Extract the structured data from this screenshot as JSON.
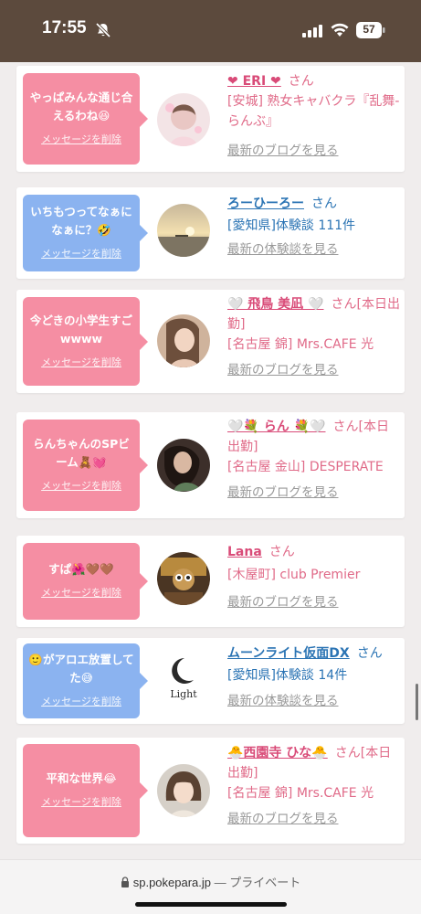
{
  "status_bar": {
    "time": "17:55",
    "battery": "57",
    "icons": [
      "mute-icon",
      "signal-icon",
      "wifi-icon",
      "battery-icon"
    ]
  },
  "colors": {
    "header": "#5c4a3d",
    "bubble_pink": "#f58ea3",
    "bubble_blue": "#8bb3f0",
    "name_pink": "#d94b78",
    "name_blue": "#2b74b4"
  },
  "messages": [
    {
      "bubble_text": "やっぱみんな通じ合えるわね😆",
      "delete_label": "メッセージを削除",
      "bubble_color": "pink",
      "avatar": "avatar-photo-1",
      "name": "❤ ERI ❤",
      "san": "さん",
      "shop": "[安城] 熟女キャバクラ『乱舞-らんぶ』",
      "link": "最新のブログを見る"
    },
    {
      "bubble_text": "いちもつってなぁになぁに？🤣",
      "delete_label": "メッセージを削除",
      "bubble_color": "blue",
      "avatar": "avatar-sunset",
      "name": "ろーひーろー",
      "san": "さん",
      "shop": "[愛知県]体験談 111件",
      "link": "最新の体験談を見る"
    },
    {
      "bubble_text": "今どきの小学生すごwwww",
      "delete_label": "メッセージを削除",
      "bubble_color": "pink",
      "avatar": "avatar-photo-3",
      "name": "🤍 飛鳥 美凪 🤍",
      "san": "さん[本日出勤]",
      "shop": "[名古屋 錦] Mrs.CAFE 光",
      "link": "最新のブログを見る"
    },
    {
      "bubble_text": "らんちゃんのSPビーム🧸💓",
      "delete_label": "メッセージを削除",
      "bubble_color": "pink",
      "avatar": "avatar-photo-4",
      "name": "🤍💐 らん 💐🤍",
      "san": "さん[本日出勤]",
      "shop": "[名古屋 金山] DESPERATE",
      "link": "最新のブログを見る"
    },
    {
      "bubble_text": "すぱ🌺🤎🤎",
      "delete_label": "メッセージを削除",
      "bubble_color": "pink",
      "avatar": "avatar-photo-5",
      "name": "Lana",
      "san": "さん",
      "shop": "[木屋町] club Premier",
      "link": "最新のブログを見る"
    },
    {
      "bubble_text": "🙂がアロエ放置してた😅",
      "delete_label": "メッセージを削除",
      "bubble_color": "blue",
      "avatar": "avatar-light-logo",
      "name": "ムーンライト仮面DX",
      "san": "さん",
      "shop": "[愛知県]体験談 14件",
      "link": "最新の体験談を見る",
      "logo_text": "Light"
    },
    {
      "bubble_text": "平和な世界😂",
      "delete_label": "メッセージを削除",
      "bubble_color": "pink",
      "avatar": "avatar-photo-7",
      "name": "🐣西園寺 ひな🐣",
      "san": "さん[本日出勤]",
      "shop": "[名古屋 錦] Mrs.CAFE 光",
      "link": "最新のブログを見る"
    }
  ],
  "url_bar": {
    "domain": "sp.pokepara.jp",
    "separator": " — ",
    "privacy": "プライベート"
  }
}
